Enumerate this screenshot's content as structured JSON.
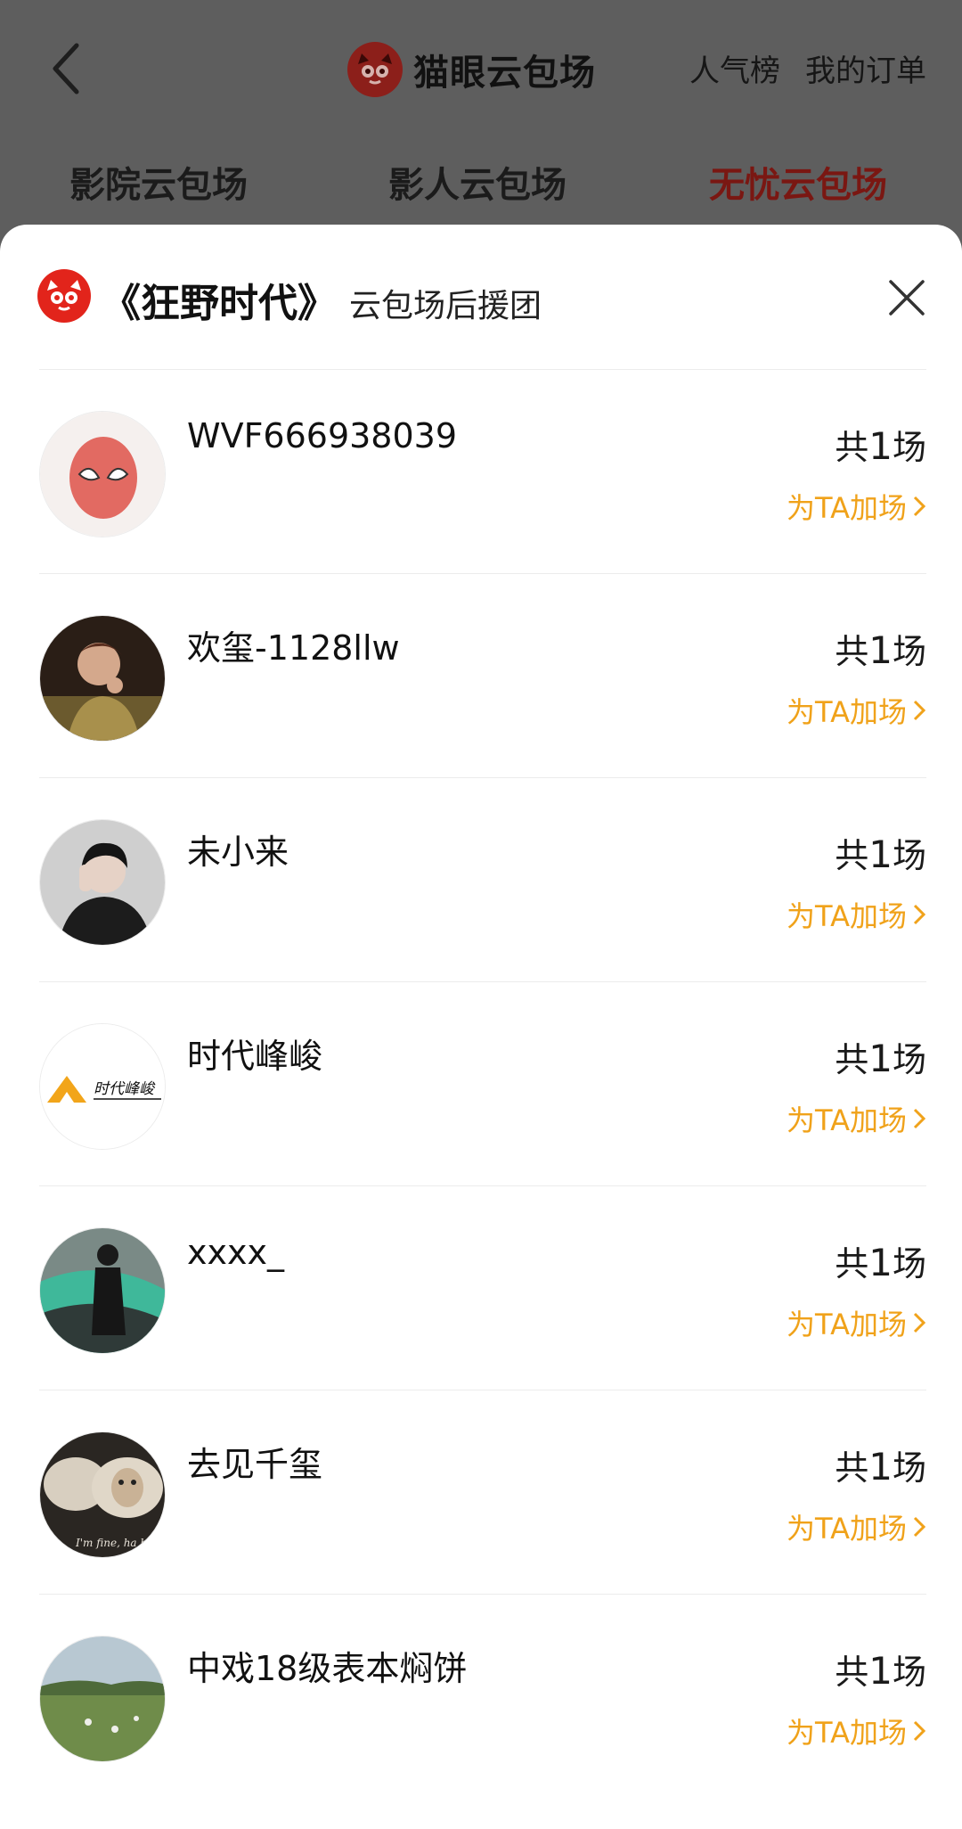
{
  "header": {
    "back_icon": "chevron-left-icon",
    "brand_name": "猫眼云包场",
    "links": [
      "人气榜",
      "我的订单"
    ],
    "tabs": [
      {
        "label": "影院云包场",
        "active": false
      },
      {
        "label": "影人云包场",
        "active": false
      },
      {
        "label": "无忧云包场",
        "active": true
      }
    ]
  },
  "sheet": {
    "movie_title": "《狂野时代》",
    "title_suffix": "云包场后援团",
    "close_icon": "close-icon"
  },
  "supporters": [
    {
      "name": "WVF666938039",
      "count_prefix": "共",
      "count": "1",
      "count_suffix": "场",
      "action": "为TA加场"
    },
    {
      "name": "欢玺-1128llw",
      "count_prefix": "共",
      "count": "1",
      "count_suffix": "场",
      "action": "为TA加场"
    },
    {
      "name": "未小来",
      "count_prefix": "共",
      "count": "1",
      "count_suffix": "场",
      "action": "为TA加场"
    },
    {
      "name": "时代峰峻",
      "count_prefix": "共",
      "count": "1",
      "count_suffix": "场",
      "action": "为TA加场",
      "avatar_text": "时代峰峻"
    },
    {
      "name": "xxxx_",
      "count_prefix": "共",
      "count": "1",
      "count_suffix": "场",
      "action": "为TA加场"
    },
    {
      "name": "去见千玺",
      "count_prefix": "共",
      "count": "1",
      "count_suffix": "场",
      "action": "为TA加场",
      "avatar_text": "I'm fine, ha ha"
    },
    {
      "name": "中戏18级表本焖饼",
      "count_prefix": "共",
      "count": "1",
      "count_suffix": "场",
      "action": "为TA加场"
    }
  ],
  "colors": {
    "overlay": "#5e5e5e",
    "brand_red": "#e2241b",
    "active_tab": "#7a1712",
    "action": "#f0a21a"
  }
}
